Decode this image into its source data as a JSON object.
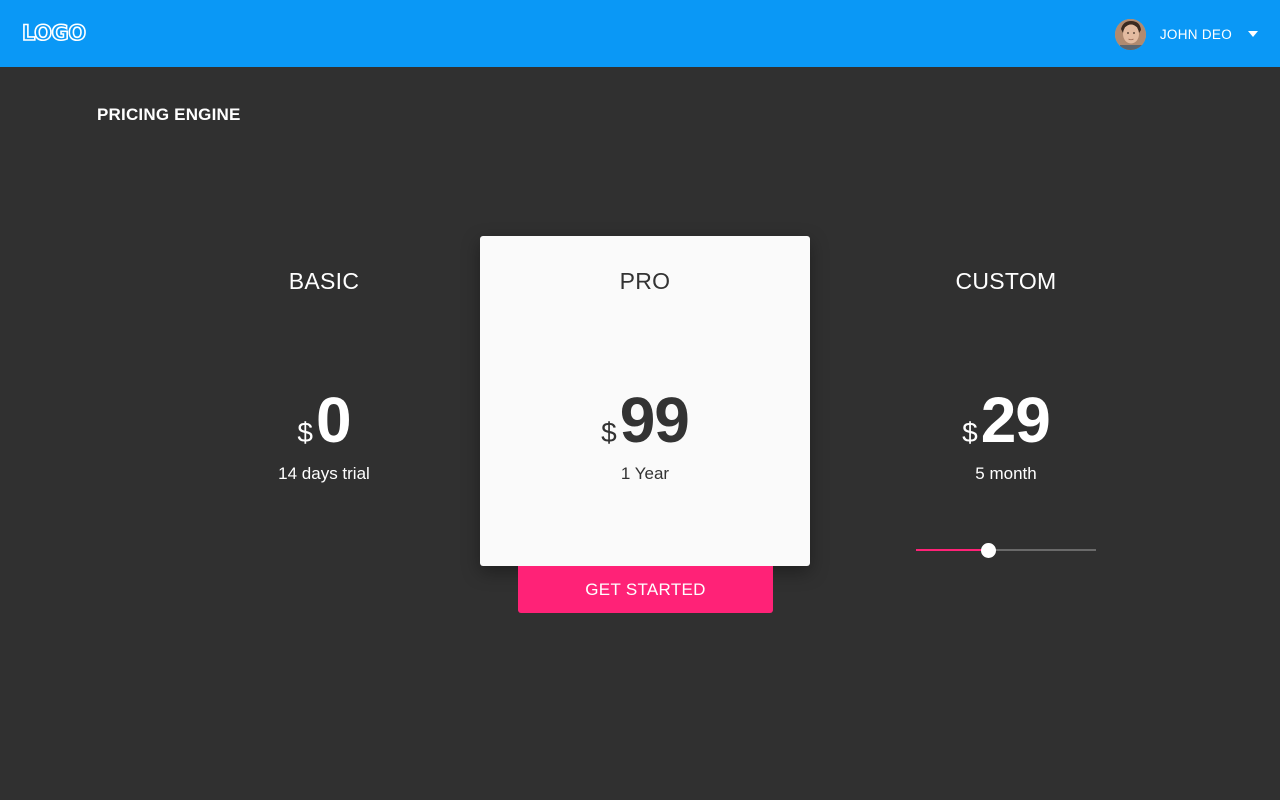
{
  "header": {
    "logo_text": "LOGO",
    "user": {
      "name": "JOHN DEO"
    },
    "colors": {
      "bar": "#0a98f6"
    }
  },
  "page": {
    "title": "PRICING ENGINE"
  },
  "plans": [
    {
      "name": "BASIC",
      "currency": "$",
      "price": "0",
      "term": "14 days trial"
    },
    {
      "name": "PRO",
      "currency": "$",
      "price": "99",
      "term": "1 Year",
      "cta": "GET STARTED"
    },
    {
      "name": "CUSTOM",
      "currency": "$",
      "price": "29",
      "term": "5 month"
    }
  ],
  "custom_slider": {
    "value_fraction": 0.4
  },
  "colors": {
    "background": "#303030",
    "card": "#fafafa",
    "accent": "#ff2277"
  }
}
